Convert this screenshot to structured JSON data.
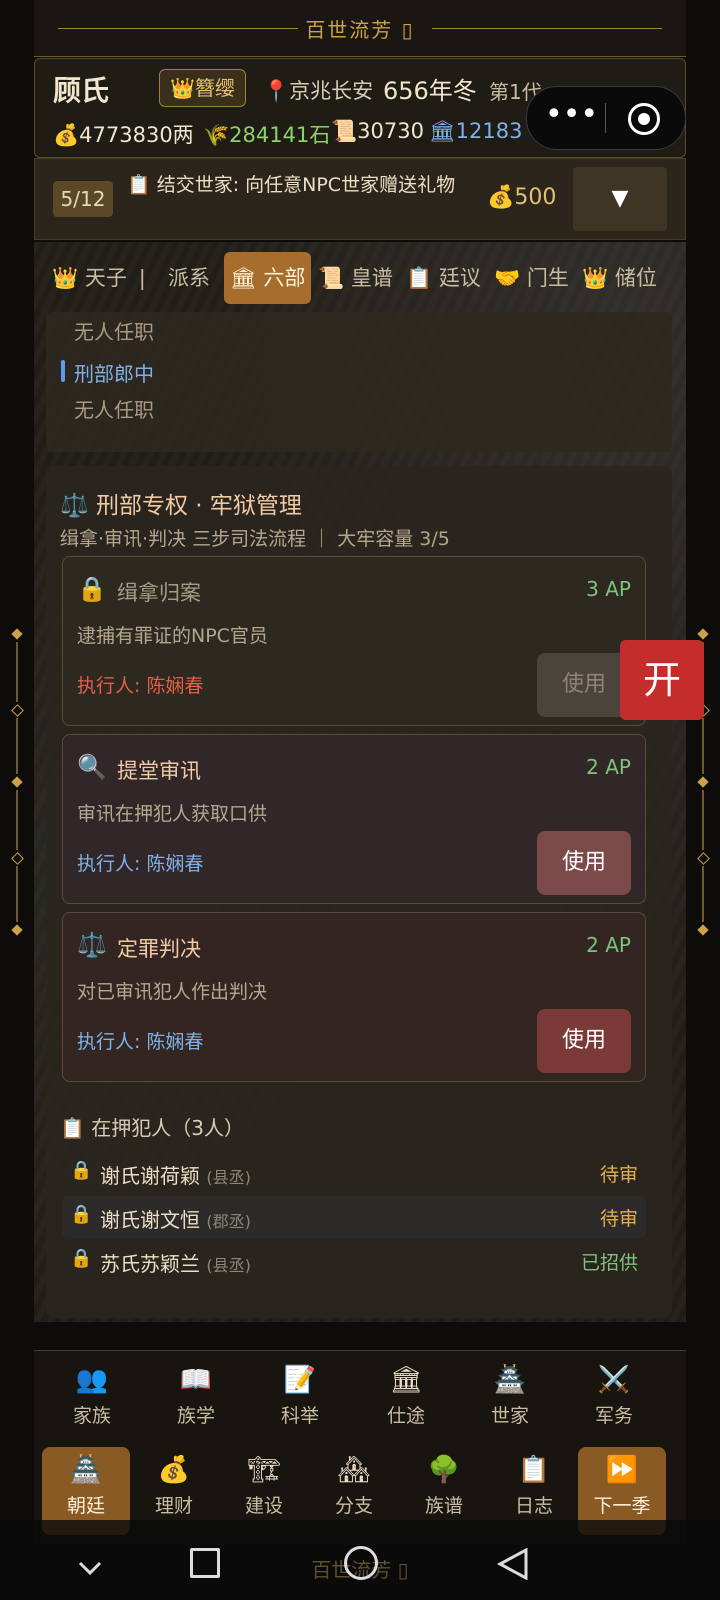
{
  "title_bar": {
    "title": "百世流芳 ▯"
  },
  "header": {
    "clan_name": "顾氏",
    "rank": "👑簪缨",
    "location": "京兆长安",
    "year": "656年冬",
    "generation": "第1代",
    "resources": {
      "money": "💰4773830两",
      "grain": "🌾284141石",
      "scroll": "📜30730",
      "prestige": "🏛12183"
    }
  },
  "task": {
    "count": "5/12",
    "text": "📋 结交世家: 向任意NPC世家赠送礼物",
    "cost": "💰500",
    "dropdown": "▼"
  },
  "tabs": [
    {
      "label": "👑 天子 ❘"
    },
    {
      "label": "派系"
    },
    {
      "label": "🏛 六部"
    },
    {
      "label": "📜 皇谱"
    },
    {
      "label": "📋 廷议"
    },
    {
      "label": "🤝 门生"
    },
    {
      "label": "👑 储位"
    }
  ],
  "offices": {
    "vacant_1": "无人任职",
    "post": "刑部郎中",
    "vacant_2": "无人任职"
  },
  "power": {
    "title": "⚖️ 刑部专权 · 牢狱管理",
    "subtitle": "缉拿·审讯·判决 三步司法流程  ｜  大牢容量 3/5"
  },
  "skills": [
    {
      "icon": "🔒",
      "name": "缉拿归案",
      "ap": "3 AP",
      "desc": "逮捕有罪证的NPC官员",
      "executor": "执行人: 陈娴春",
      "button": "使用"
    },
    {
      "icon": "🔍",
      "name": "提堂审讯",
      "ap": "2 AP",
      "desc": "审讯在押犯人获取口供",
      "executor": "执行人: 陈娴春",
      "button": "使用"
    },
    {
      "icon": "⚖️",
      "name": "定罪判决",
      "ap": "2 AP",
      "desc": "对已审讯犯人作出判决",
      "executor": "执行人: 陈娴春",
      "button": "使用"
    }
  ],
  "prison": {
    "title": "📋 在押犯人（3人）",
    "prisoners": [
      {
        "name": "谢氏谢荷颖",
        "post": "(县丞)",
        "status": "待审"
      },
      {
        "name": "谢氏谢文恒",
        "post": "(郡丞)",
        "status": "待审"
      },
      {
        "name": "苏氏苏颖兰",
        "post": "(县丞)",
        "status": "已招供"
      }
    ]
  },
  "open_button": "开",
  "nav_row1": [
    {
      "icon": "👥",
      "label": "家族"
    },
    {
      "icon": "📖",
      "label": "族学"
    },
    {
      "icon": "📝",
      "label": "科举"
    },
    {
      "icon": "🏛",
      "label": "仕途"
    },
    {
      "icon": "🏯",
      "label": "世家"
    },
    {
      "icon": "⚔️",
      "label": "军务"
    }
  ],
  "nav_row2": [
    {
      "icon": "🏯",
      "label": "朝廷"
    },
    {
      "icon": "💰",
      "label": "理财"
    },
    {
      "icon": "🏗",
      "label": "建设"
    },
    {
      "icon": "🏘",
      "label": "分支"
    },
    {
      "icon": "🌳",
      "label": "族谱"
    },
    {
      "icon": "📋",
      "label": "日志"
    },
    {
      "icon": "⏩",
      "label": "下一季"
    }
  ],
  "footer_title": "百世流芳 ▯",
  "colors": {
    "accent": "#a76d2c",
    "gold": "#c9a24a",
    "red": "#c52c2c",
    "ap_green": "#7cc47b"
  }
}
